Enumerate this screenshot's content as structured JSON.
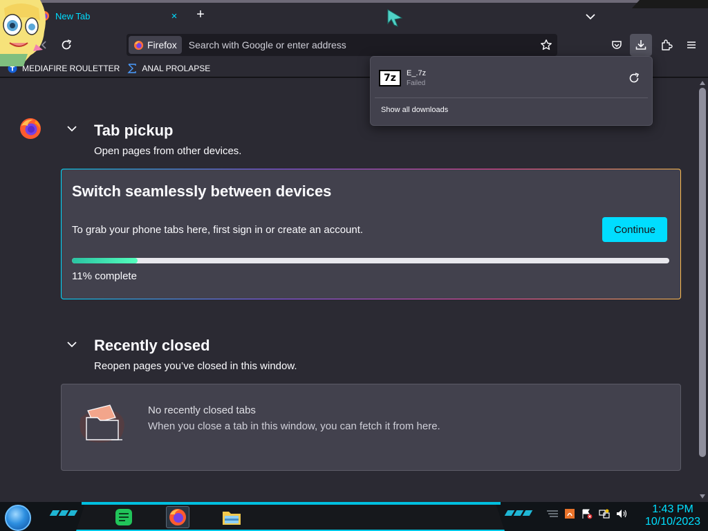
{
  "browser": {
    "tab": {
      "label": "New Tab",
      "close_symbol": "×"
    },
    "new_tab_symbol": "+",
    "identity_label": "Firefox",
    "url_placeholder": "Search with Google or enter address",
    "icons": [
      "back-arrow-icon",
      "reload-icon",
      "star-icon",
      "pocket-icon",
      "download-icon",
      "extensions-icon",
      "menu-icon"
    ]
  },
  "bookmarks": [
    {
      "label": "MEDIAFIRE ROULETTER",
      "icon": "bookmark-t-icon"
    },
    {
      "label": "ANAL PROLAPSE",
      "icon": "bookmark-sigma-icon"
    }
  ],
  "downloads_panel": {
    "item": {
      "filetype": "7z",
      "name": "E_.7z",
      "status": "Failed"
    },
    "show_all": "Show all downloads"
  },
  "tab_pickup": {
    "title": "Tab pickup",
    "subtitle": "Open pages from other devices.",
    "card": {
      "title": "Switch seamlessly between devices",
      "description": "To grab your phone tabs here, first sign in or create an account.",
      "button": "Continue",
      "progress": 0.11,
      "progress_label": "11% complete"
    }
  },
  "recently_closed": {
    "title": "Recently closed",
    "subtitle": "Reopen pages you’ve closed in this window.",
    "empty_title": "No recently closed tabs",
    "empty_desc": "When you close a tab in this window, you can fetch it from here."
  },
  "taskbar": {
    "time": "1:43 PM",
    "date": "10/10/2023",
    "apps": [
      "notes-app-icon",
      "firefox-icon",
      "file-explorer-icon"
    ]
  },
  "colors": {
    "accent": "#00ddff",
    "page_bg": "#2b2a33",
    "card_bg": "#42414d",
    "progress": "#2ac3a2"
  }
}
